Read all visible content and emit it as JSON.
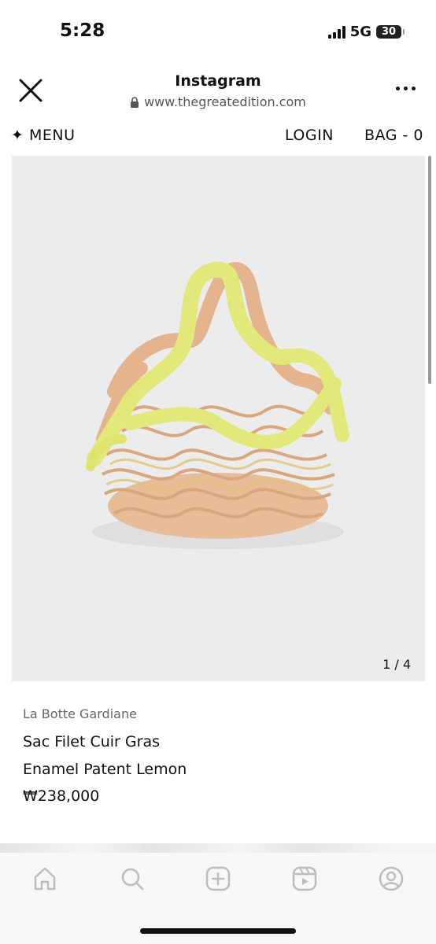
{
  "status_bar": {
    "time": "5:28",
    "network": "5G",
    "battery": "30"
  },
  "browser": {
    "title": "Instagram",
    "url": "www.thegreatedition.com"
  },
  "site_nav": {
    "menu_label": "✦ MENU",
    "login_label": "LOGIN",
    "bag_label": "BAG - 0"
  },
  "product": {
    "image_counter": "1 / 4",
    "brand": "La Botte Gardiane",
    "name_line1": "Sac Filet Cuir Gras",
    "name_line2": "Enamel Patent Lemon",
    "price": "₩238,000"
  },
  "tab_bar": {
    "icons": [
      "home-icon",
      "search-icon",
      "create-icon",
      "reels-icon",
      "profile-icon"
    ]
  },
  "colors": {
    "image_bg": "#ececec",
    "bag_yellow": "#e2e87a",
    "bag_tan": "#e3b48d",
    "tab_icon": "#bdbdbd"
  }
}
